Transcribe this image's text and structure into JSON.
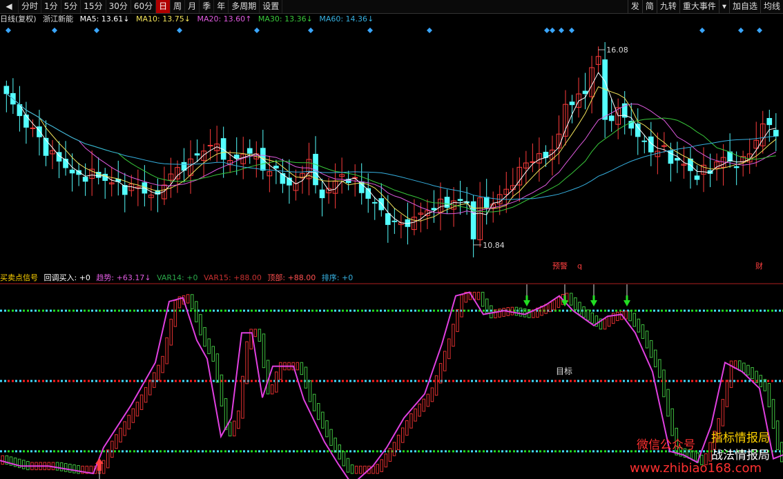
{
  "toolbar": {
    "left_icon": "play-back-icon",
    "periods": [
      "分时",
      "1分",
      "5分",
      "15分",
      "30分",
      "60分",
      "日",
      "周",
      "月",
      "季",
      "年",
      "多周期",
      "设置"
    ],
    "active_period": "日",
    "right_items": [
      "发",
      "简",
      "九转",
      "重大事件",
      "加自选",
      "均线"
    ],
    "dropdown_icon": "caret-down-icon"
  },
  "main_header": {
    "period_label": "日线(复权)",
    "stock_name": "浙江新能",
    "ma": [
      {
        "label": "MA5: 13.61",
        "arrow": "↓",
        "color": "#ffffff"
      },
      {
        "label": "MA10: 13.75",
        "arrow": "↓",
        "color": "#f2e35a"
      },
      {
        "label": "MA20: 13.60",
        "arrow": "↑",
        "color": "#e05be0"
      },
      {
        "label": "MA30: 13.36",
        "arrow": "↓",
        "color": "#39c93b"
      },
      {
        "label": "MA60: 14.36",
        "arrow": "↓",
        "color": "#36b0e0"
      }
    ]
  },
  "price_labels": {
    "high": "16.08",
    "low": "10.84"
  },
  "main_annotations": {
    "a": "预警",
    "b": "q",
    "c": "财"
  },
  "indicator_header": {
    "title": "买卖点信号",
    "items": [
      {
        "text": "回调买入: +0",
        "color": "#ffffff"
      },
      {
        "text": "趋势: +63.17↓",
        "color": "#e05be0"
      },
      {
        "text": "VAR14: +0",
        "color": "#2aa84a"
      },
      {
        "text": "VAR15: +88.00",
        "color": "#c83030"
      },
      {
        "text": "顶部: +88.00",
        "color": "#ff5050"
      },
      {
        "text": "排序: +0",
        "color": "#36b0e0"
      }
    ]
  },
  "target_label": "目标",
  "watermarks": {
    "line1": "微信公众号",
    "line2": "指标情报局",
    "line3": "战法情报局",
    "url": "www.zhibiao168.com"
  },
  "colors": {
    "up": "#ff3c3c",
    "down": "#54ffff",
    "ma5": "#ffffff",
    "ma10": "#f2e35a",
    "ma20": "#e05be0",
    "ma30": "#39c93b",
    "ma60": "#36b0e0",
    "trend": "#e040e0",
    "bar_up": "#e03030",
    "bar_down": "#40c040",
    "line_green": "#22dd22",
    "line_cyan": "#44ddff",
    "line_red": "#ff2020"
  },
  "chart_data": [
    {
      "type": "candlestick",
      "title": "浙江新能 日线(复权)",
      "y_range": [
        10.3,
        16.6
      ],
      "annotated_extremes": {
        "high": 16.08,
        "low": 10.84
      },
      "ma_series": [
        {
          "name": "MA5",
          "last": 13.61
        },
        {
          "name": "MA10",
          "last": 13.75
        },
        {
          "name": "MA20",
          "last": 13.6
        },
        {
          "name": "MA30",
          "last": 13.36
        },
        {
          "name": "MA60",
          "last": 14.36
        }
      ]
    },
    {
      "type": "line",
      "title": "买卖点信号",
      "y_range": [
        0,
        100
      ],
      "reference_lines": [
        88,
        50,
        12
      ],
      "series": [
        {
          "name": "趋势",
          "last": 63.17
        }
      ]
    }
  ]
}
